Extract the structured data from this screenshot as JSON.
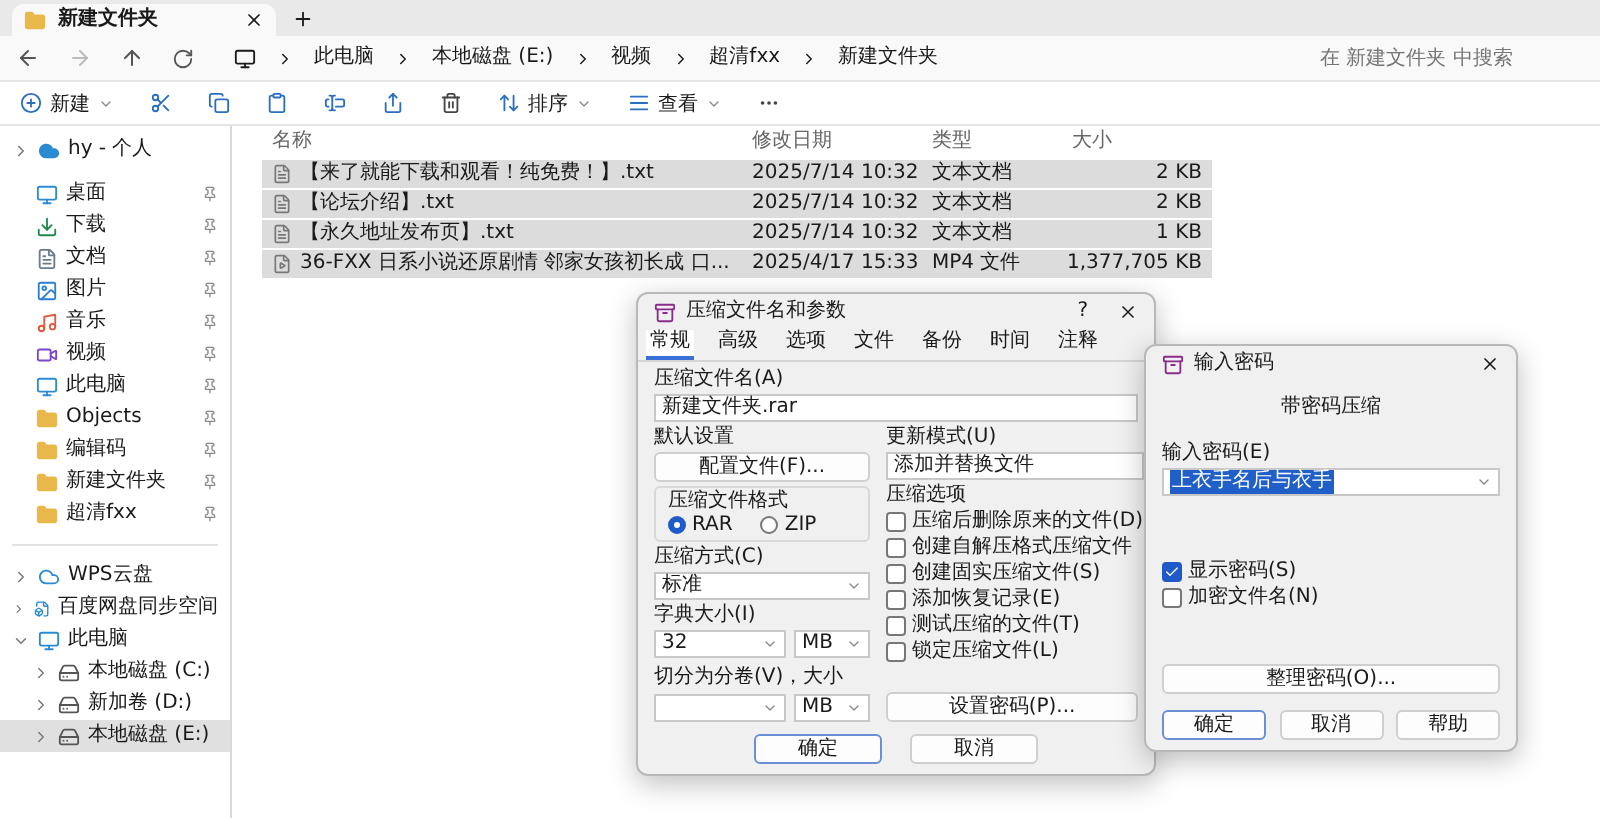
{
  "tabs": [
    {
      "label": "新建文件夹",
      "selected": true
    }
  ],
  "address": {
    "crumbs": [
      "此电脑",
      "本地磁盘 (E:)",
      "视频",
      "超清fxx",
      "新建文件夹"
    ],
    "search_placeholder": "在 新建文件夹 中搜索"
  },
  "toolbar": [
    {
      "kind": "new",
      "label": "新建"
    },
    {
      "kind": "cut"
    },
    {
      "kind": "copy"
    },
    {
      "kind": "paste"
    },
    {
      "kind": "rename"
    },
    {
      "kind": "share"
    },
    {
      "kind": "delete"
    },
    {
      "kind": "sort",
      "label": "排序"
    },
    {
      "kind": "view",
      "label": "查看"
    },
    {
      "kind": "more"
    }
  ],
  "sidebar": {
    "account": {
      "label": "hy - 个人",
      "expanded": false
    },
    "pinned": [
      {
        "kind": "desktop",
        "label": "桌面"
      },
      {
        "kind": "download",
        "label": "下载"
      },
      {
        "kind": "documents",
        "label": "文档"
      },
      {
        "kind": "pictures",
        "label": "图片"
      },
      {
        "kind": "music",
        "label": "音乐"
      },
      {
        "kind": "videos",
        "label": "视频"
      },
      {
        "kind": "pc",
        "label": "此电脑"
      },
      {
        "kind": "folder",
        "label": "Objects"
      },
      {
        "kind": "folder",
        "label": "编辑码"
      },
      {
        "kind": "folder",
        "label": "新建文件夹"
      },
      {
        "kind": "folder",
        "label": "超清fxx"
      }
    ],
    "tree": [
      {
        "kind": "cloud",
        "label": "WPS云盘",
        "expanded": false,
        "selected": false
      },
      {
        "kind": "netdisk",
        "label": "百度网盘同步空间",
        "expanded": false,
        "selected": false
      },
      {
        "kind": "pc",
        "label": "此电脑",
        "expanded": true,
        "selected": false,
        "children": [
          {
            "kind": "drive",
            "label": "本地磁盘 (C:)",
            "expanded": false,
            "selected": false
          },
          {
            "kind": "drive",
            "label": "新加卷 (D:)",
            "expanded": false,
            "selected": false
          },
          {
            "kind": "drive",
            "label": "本地磁盘 (E:)",
            "expanded": false,
            "selected": true
          }
        ]
      }
    ]
  },
  "files": {
    "columns": [
      "名称",
      "修改日期",
      "类型",
      "大小"
    ],
    "rows": [
      {
        "kind": "text",
        "name": "【来了就能下载和观看！纯免费！】.txt",
        "date": "2025/7/14 10:32",
        "type": "文本文档",
        "size": "2 KB",
        "selected": true
      },
      {
        "kind": "text",
        "name": "【论坛介绍】.txt",
        "date": "2025/7/14 10:32",
        "type": "文本文档",
        "size": "2 KB",
        "selected": true
      },
      {
        "kind": "text",
        "name": "【永久地址发布页】.txt",
        "date": "2025/7/14 10:32",
        "type": "文本文档",
        "size": "1 KB",
        "selected": true
      },
      {
        "kind": "video",
        "name": "36-FXX 日系小说还原剧情 邻家女孩初长成 口...",
        "date": "2025/4/17 15:33",
        "type": "MP4 文件",
        "size": "1,377,705 KB",
        "selected": true
      }
    ]
  },
  "archive_dialog": {
    "title": "压缩文件名和参数",
    "help": "?",
    "tabs": [
      {
        "label": "常规",
        "selected": true
      },
      {
        "label": "高级",
        "selected": false
      },
      {
        "label": "选项",
        "selected": false
      },
      {
        "label": "文件",
        "selected": false
      },
      {
        "label": "备份",
        "selected": false
      },
      {
        "label": "时间",
        "selected": false
      },
      {
        "label": "注释",
        "selected": false
      }
    ],
    "filename_label": "压缩文件名(A)",
    "filename": "新建文件夹.rar",
    "profile_label": "默认设置",
    "profile_button": "配置文件(F)...",
    "update_label": "更新模式(U)",
    "update_value": "添加并替换文件",
    "format_label": "压缩文件格式",
    "formats": [
      {
        "label": "RAR",
        "selected": true
      },
      {
        "label": "ZIP",
        "selected": false
      }
    ],
    "options_label": "压缩选项",
    "options": [
      {
        "label": "压缩后删除原来的文件(D)",
        "checked": false
      },
      {
        "label": "创建自解压格式压缩文件",
        "checked": false
      },
      {
        "label": "创建固实压缩文件(S)",
        "checked": false
      },
      {
        "label": "添加恢复记录(E)",
        "checked": false
      },
      {
        "label": "测试压缩的文件(T)",
        "checked": false
      },
      {
        "label": "锁定压缩文件(L)",
        "checked": false
      }
    ],
    "method_label": "压缩方式(C)",
    "method": "标准",
    "dict_label": "字典大小(I)",
    "dict": "32",
    "dict_unit": "MB",
    "split_label": "切分为分卷(V)，大小",
    "split_unit": "MB",
    "password_button": "设置密码(P)...",
    "buttons": [
      "确定",
      "取消"
    ]
  },
  "password_dialog": {
    "title": "输入密码",
    "heading": "带密码压缩",
    "field_label": "输入密码(E)",
    "value": "上衣手名后与衣手",
    "options": [
      {
        "label": "显示密码(S)",
        "checked": true
      },
      {
        "label": "加密文件名(N)",
        "checked": false
      }
    ],
    "organize_button": "整理密码(O)...",
    "buttons": [
      "确定",
      "取消",
      "帮助"
    ]
  }
}
